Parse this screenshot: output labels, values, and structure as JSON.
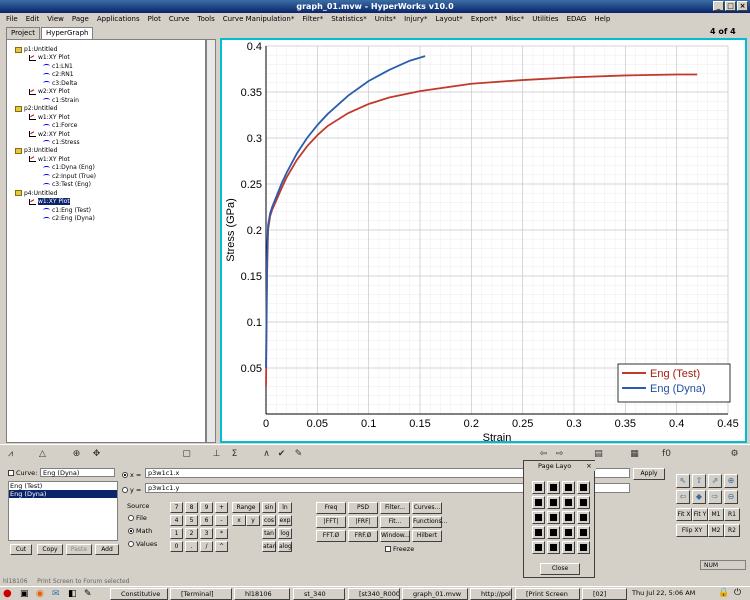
{
  "window": {
    "title": "graph_01.mvw - HyperWorks v10.0"
  },
  "menu": [
    "File",
    "Edit",
    "View",
    "Page",
    "Applications",
    "Plot",
    "Curve",
    "Tools",
    "Curve Manipulation*",
    "Filter*",
    "Statistics*",
    "Units*",
    "Injury*",
    "Layout*",
    "Export*",
    "Misc*",
    "Utilities",
    "EDAG",
    "Help"
  ],
  "left_tabs": [
    "Project",
    "HyperGraph"
  ],
  "tree": [
    {
      "label": "p1:Untitled",
      "level": 0,
      "kind": "page"
    },
    {
      "label": "w1:XY Plot",
      "level": 1,
      "kind": "plot"
    },
    {
      "label": "c1:LN1",
      "level": 2,
      "kind": "curve"
    },
    {
      "label": "c2:RN1",
      "level": 2,
      "kind": "curve"
    },
    {
      "label": "c3:Delta",
      "level": 2,
      "kind": "curve"
    },
    {
      "label": "w2:XY Plot",
      "level": 1,
      "kind": "plot"
    },
    {
      "label": "c1:Strain",
      "level": 2,
      "kind": "curve"
    },
    {
      "label": "p2:Untitled",
      "level": 0,
      "kind": "page"
    },
    {
      "label": "w1:XY Plot",
      "level": 1,
      "kind": "plot"
    },
    {
      "label": "c1:Force",
      "level": 2,
      "kind": "curve"
    },
    {
      "label": "w2:XY Plot",
      "level": 1,
      "kind": "plot"
    },
    {
      "label": "c1:Stress",
      "level": 2,
      "kind": "curve"
    },
    {
      "label": "p3:Untitled",
      "level": 0,
      "kind": "page"
    },
    {
      "label": "w1:XY Plot",
      "level": 1,
      "kind": "plot"
    },
    {
      "label": "c1:Dyna (Eng)",
      "level": 2,
      "kind": "curve"
    },
    {
      "label": "c2:Input (True)",
      "level": 2,
      "kind": "curve"
    },
    {
      "label": "c3:Test (Eng)",
      "level": 2,
      "kind": "curve"
    },
    {
      "label": "p4:Untitled",
      "level": 0,
      "kind": "page"
    },
    {
      "label": "w1:XY Plot",
      "level": 1,
      "kind": "plot",
      "selected": true
    },
    {
      "label": "c1:Eng (Test)",
      "level": 2,
      "kind": "curve"
    },
    {
      "label": "c2:Eng (Dyna)",
      "level": 2,
      "kind": "curve"
    }
  ],
  "page_counter": "4 of 4",
  "chart_data": {
    "type": "line",
    "xlabel": "Strain",
    "ylabel": "Stress (GPa)",
    "xlim": [
      0,
      0.45
    ],
    "ylim": [
      0,
      0.4
    ],
    "xticks": [
      0,
      0.05,
      0.1,
      0.15,
      0.2,
      0.25,
      0.3,
      0.35,
      0.4,
      0.45
    ],
    "yticks": [
      0.05,
      0.1,
      0.15,
      0.2,
      0.25,
      0.3,
      0.35,
      0.4
    ],
    "grid": true,
    "legend_position": "bottom-right",
    "series": [
      {
        "name": "Eng (Test)",
        "color": "#c0392b",
        "x": [
          0,
          0.001,
          0.002,
          0.004,
          0.006,
          0.01,
          0.015,
          0.02,
          0.03,
          0.04,
          0.05,
          0.06,
          0.08,
          0.1,
          0.12,
          0.15,
          0.2,
          0.25,
          0.3,
          0.35,
          0.4,
          0.42
        ],
        "y": [
          0.03,
          0.15,
          0.2,
          0.215,
          0.222,
          0.232,
          0.245,
          0.257,
          0.276,
          0.291,
          0.303,
          0.313,
          0.327,
          0.337,
          0.344,
          0.351,
          0.359,
          0.363,
          0.366,
          0.368,
          0.369,
          0.369
        ]
      },
      {
        "name": "Eng (Dyna)",
        "color": "#2a5db0",
        "x": [
          0,
          0.001,
          0.002,
          0.004,
          0.006,
          0.01,
          0.015,
          0.02,
          0.03,
          0.04,
          0.05,
          0.06,
          0.08,
          0.1,
          0.12,
          0.14,
          0.155
        ],
        "y": [
          0.05,
          0.17,
          0.205,
          0.218,
          0.225,
          0.236,
          0.25,
          0.262,
          0.283,
          0.3,
          0.314,
          0.326,
          0.346,
          0.362,
          0.374,
          0.384,
          0.389
        ]
      }
    ]
  },
  "toolbar_icons": [
    "curve-tool-icon",
    "axis-icon",
    "zoom-icon",
    "pan-icon",
    "note-icon",
    "datum-icon",
    "sum-icon",
    "fx-icon",
    "check-icon",
    "eraser-icon"
  ],
  "curve_panel": {
    "curve_label": "Curve:",
    "curve_value": "Eng (Dyna)",
    "curves": [
      "Eng (Test)",
      "Eng (Dyna)"
    ],
    "x_label": "x =",
    "x_value": "p3w1c1.x",
    "y_label": "y =",
    "y_value": "p3w1c1.y",
    "apply": "Apply",
    "list_buttons": [
      "Cut",
      "Copy",
      "Paste",
      "Add"
    ],
    "source_label": "Source",
    "sources": [
      "File",
      "Math",
      "Values"
    ],
    "source_selected": "Math",
    "keypad": [
      "7",
      "8",
      "9",
      "+",
      "4",
      "5",
      "6",
      "-",
      "1",
      "2",
      "3",
      "*",
      "0",
      ".",
      "/",
      "^"
    ],
    "funcs": [
      "Range",
      "sin",
      "ln",
      "x",
      "y",
      "cos",
      "exp",
      "tan",
      "log",
      "atan",
      "alog"
    ],
    "ops": [
      "Freq",
      "PSD",
      "Filter...",
      "Curves...",
      "|FFT|",
      "|FRF|",
      "Fit...",
      "Functions...",
      "FFT.Ø",
      "FRF.Ø",
      "Window...",
      "Hilbert"
    ],
    "freeze": "Freeze"
  },
  "page_layout": {
    "title": "Page Layo",
    "close": "Close"
  },
  "right_controls": [
    "Fit X",
    "Fit Y",
    "M1",
    "R1",
    "Flip XY",
    "M2",
    "R2"
  ],
  "status": {
    "line": "Print Screen to Forum  selected",
    "num": "NUM",
    "left": "hl18106"
  },
  "taskbar": {
    "tasks": [
      "Constitutive",
      "[Terminal]",
      "hl18106",
      "st_340",
      "[st340_R000",
      "graph_01.mvw",
      "http://polymo",
      "[Print Screen",
      "[02]"
    ],
    "clock": "Thu Jul 22,  5:06 AM"
  },
  "colors": {
    "accent": "#00bcd4",
    "titlebar": "#0a246a",
    "selection": "#0a246a"
  }
}
